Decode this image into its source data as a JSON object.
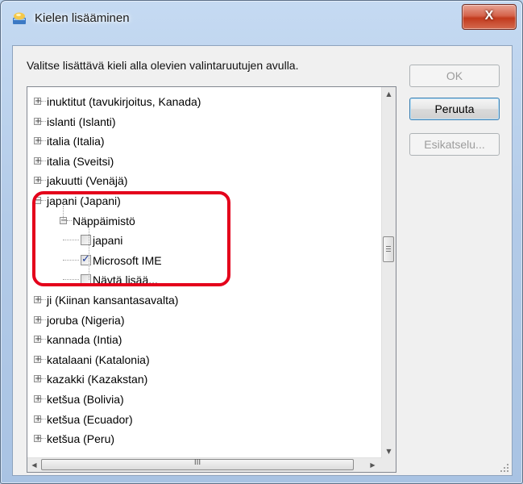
{
  "window": {
    "title": "Kielen lisääminen",
    "close_symbol": "X",
    "icon": "language-globe-icon"
  },
  "instruction": "Valitse lisättävä kieli alla olevien valintaruutujen avulla.",
  "buttons": {
    "ok": "OK",
    "cancel": "Peruuta",
    "preview": "Esikatselu..."
  },
  "tree": {
    "rows": [
      {
        "label": "inuktitut (tavukirjoitus, Kanada)",
        "level": 0,
        "expander": "+",
        "checkbox": false
      },
      {
        "label": "islanti (Islanti)",
        "level": 0,
        "expander": "+",
        "checkbox": false
      },
      {
        "label": "italia (Italia)",
        "level": 0,
        "expander": "+",
        "checkbox": false
      },
      {
        "label": "italia (Sveitsi)",
        "level": 0,
        "expander": "+",
        "checkbox": false
      },
      {
        "label": "jakuutti (Venäjä)",
        "level": 0,
        "expander": "+",
        "checkbox": false
      },
      {
        "label": "japani (Japani)",
        "level": 0,
        "expander": "−",
        "checkbox": false
      },
      {
        "label": "Näppäimistö",
        "level": 1,
        "expander": "−",
        "checkbox": false
      },
      {
        "label": "japani",
        "level": 2,
        "expander": "",
        "checkbox": true,
        "checked": false
      },
      {
        "label": "Microsoft IME",
        "level": 2,
        "expander": "",
        "checkbox": true,
        "checked": true
      },
      {
        "label": "Näytä lisää...",
        "level": 2,
        "expander": "",
        "checkbox": true,
        "checked": false
      },
      {
        "label": "ji (Kiinan kansantasavalta)",
        "level": 0,
        "expander": "+",
        "checkbox": false
      },
      {
        "label": "joruba (Nigeria)",
        "level": 0,
        "expander": "+",
        "checkbox": false
      },
      {
        "label": "kannada (Intia)",
        "level": 0,
        "expander": "+",
        "checkbox": false
      },
      {
        "label": "katalaani (Katalonia)",
        "level": 0,
        "expander": "+",
        "checkbox": false
      },
      {
        "label": "kazakki (Kazakstan)",
        "level": 0,
        "expander": "+",
        "checkbox": false
      },
      {
        "label": "ketšua (Bolivia)",
        "level": 0,
        "expander": "+",
        "checkbox": false
      },
      {
        "label": "ketšua (Ecuador)",
        "level": 0,
        "expander": "+",
        "checkbox": false
      },
      {
        "label": "ketšua (Peru)",
        "level": 0,
        "expander": "+",
        "checkbox": false
      }
    ]
  },
  "scrollbar": {
    "up_arrow": "▲",
    "down_arrow": "▼",
    "left_arrow": "◀",
    "right_arrow": "▶",
    "thumb_grip": "III"
  },
  "colors": {
    "highlight_border": "#e4001b",
    "close_button": "#c23a1d",
    "checkmark": "#1f3d9a"
  }
}
